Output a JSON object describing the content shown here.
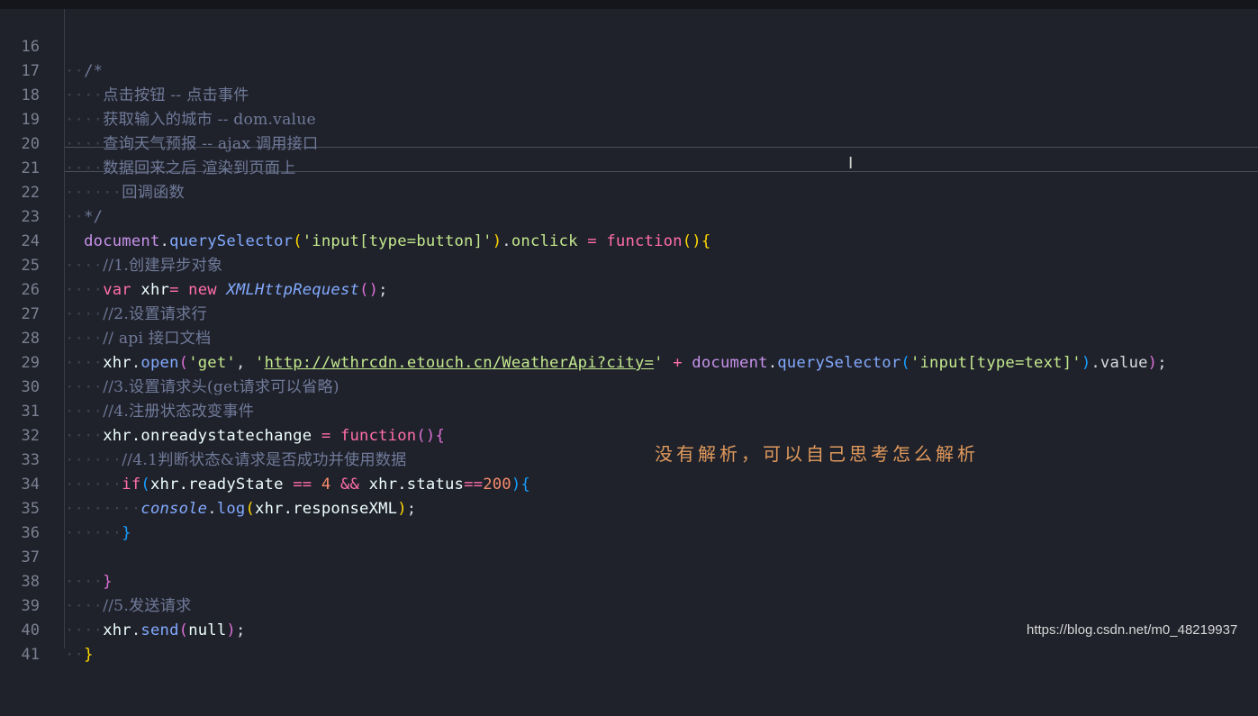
{
  "editor": {
    "line_numbers": [
      "16",
      "17",
      "18",
      "19",
      "20",
      "21",
      "22",
      "23",
      "24",
      "25",
      "26",
      "27",
      "28",
      "29",
      "30",
      "31",
      "32",
      "33",
      "34",
      "35",
      "36",
      "37",
      "38",
      "39",
      "40",
      "41"
    ],
    "lines": {
      "l16": "/*",
      "l17": "点击按钮 -- 点击事件",
      "l18": "获取输入的城市 -- dom.value",
      "l19": "查询天气预报 -- ajax 调用接口",
      "l20": "数据回来之后 渲染到页面上",
      "l21": "回调函数",
      "l22": "*/",
      "l23": {
        "document": "document",
        "dot": ".",
        "method": "querySelector",
        "open": "(",
        "arg": "'input[type=button]'",
        "close": ")",
        "dot2": ".",
        "onclick": "onclick",
        "eq": " = ",
        "function": "function",
        "parens": "()",
        "brace": "{"
      },
      "l24": "//1.创建异步对象",
      "l25": {
        "var": "var",
        "name": " xhr",
        "eq": "= ",
        "new": "new",
        "cls": "XMLHttpRequest",
        "parens": "()",
        "semi": ";"
      },
      "l26": "//2.设置请求行",
      "l27": "// api 接口文档",
      "l28": {
        "xhr": "xhr",
        "dot": ".",
        "open_method": "open",
        "open": "(",
        "get": "'get'",
        "comma": ", ",
        "url_q1": "'",
        "url": "http://wthrcdn.etouch.cn/WeatherApi?city=",
        "url_q2": "'",
        "plus": " + ",
        "document": "document",
        "dot2": ".",
        "qs": "querySelector",
        "open2": "(",
        "arg": "'input[type=text]'",
        "close2": ")",
        "value": ".value",
        "close": ")",
        "semi": ";"
      },
      "l29": "//3.设置请求头(get请求可以省略)",
      "l30": "//4.注册状态改变事件",
      "l31": {
        "xhr": "xhr",
        "prop": ".onreadystatechange",
        "eq": " = ",
        "function": "function",
        "parens": "()",
        "brace": "{"
      },
      "l32": "//4.1判断状态&请求是否成功并使用数据",
      "l33": {
        "if": "if",
        "open": "(",
        "a": "xhr.readyState",
        "op1": " == ",
        "n1": "4",
        "and": " && ",
        "b": "xhr.status",
        "op2": "==",
        "n2": "200",
        "close": ")",
        "brace": "{"
      },
      "l34": {
        "console": "console",
        "dot": ".",
        "log": "log",
        "open": "(",
        "arg": "xhr.responseXML",
        "close": ")",
        "semi": ";"
      },
      "l35": "}",
      "l36": "",
      "l37": "}",
      "l38": "//5.发送请求",
      "l39": {
        "xhr": "xhr",
        "dot": ".",
        "send": "send",
        "open": "(",
        "null": "null",
        "close": ")",
        "semi": ";"
      },
      "l40": "}",
      "l41": ""
    }
  },
  "annotation": "没有解析，可以自己思考怎么解析",
  "watermark": "https://blog.csdn.net/m0_48219937",
  "cursor_icon": "text-cursor-icon"
}
